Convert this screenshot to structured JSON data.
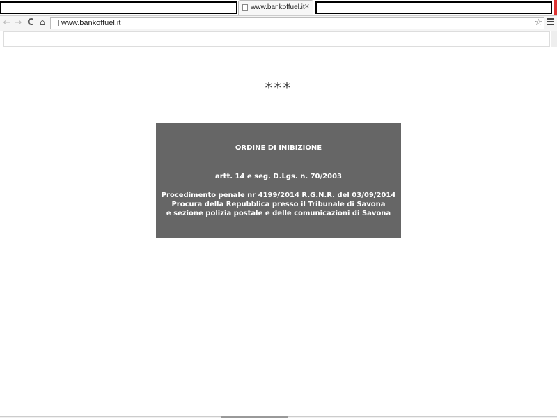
{
  "browser": {
    "tab": {
      "title": "www.bankoffuel.it",
      "close_glyph": "×"
    },
    "toolbar": {
      "back_glyph": "←",
      "forward_glyph": "→",
      "reload_glyph": "C",
      "home_glyph": "⌂",
      "url": "www.bankoffuel.it",
      "star_glyph": "☆"
    },
    "icons": [
      "page-icon",
      "back-icon",
      "forward-icon",
      "reload-icon",
      "home-icon",
      "star-icon",
      "menu-icon",
      "close-icon"
    ]
  },
  "page": {
    "decoration": "***",
    "notice": {
      "title": "ORDINE DI INIBIZIONE",
      "law": "artt. 14 e seg. D.Lgs. n. 70/2003",
      "line1": "Procedimento penale nr 4199/2014 R.G.N.R. del 03/09/2014",
      "line2": "Procura della Repubblica presso il Tribunale di Savona",
      "line3": "e sezione polizia postale e delle comunicazioni di Savona"
    },
    "colors": {
      "notice_bg": "#666666",
      "notice_text": "#ffffff"
    }
  }
}
